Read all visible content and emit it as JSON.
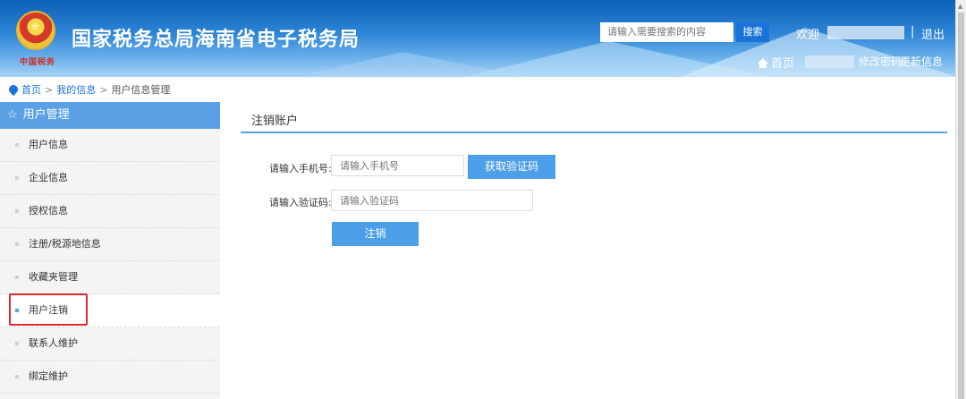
{
  "header": {
    "site_title": "国家税务总局海南省电子税务局",
    "slogan": "中国税务",
    "search_placeholder": "请输入需要搜索的内容",
    "search_label": "搜索",
    "welcome": "欢迎",
    "separator": "|",
    "logout": "退出",
    "home": "首页",
    "change_password": "修改密码",
    "update_info": "更新信息"
  },
  "breadcrumb": {
    "items": [
      "首页",
      "我的信息",
      "用户信息管理"
    ],
    "separator": ">"
  },
  "sidebar": {
    "title": "用户管理",
    "items": [
      {
        "label": "用户信息"
      },
      {
        "label": "企业信息"
      },
      {
        "label": "授权信息"
      },
      {
        "label": "注册/税源地信息"
      },
      {
        "label": "收藏夹管理"
      },
      {
        "label": "用户注销",
        "active": true
      },
      {
        "label": "联系人维护"
      },
      {
        "label": "绑定维护"
      }
    ]
  },
  "main": {
    "title": "注销账户",
    "phone_label": "请输入手机号:",
    "phone_placeholder": "请输入手机号",
    "get_code_label": "获取验证码",
    "code_label": "请输入验证码:",
    "code_placeholder": "请输入验证码",
    "submit_label": "注销"
  },
  "colors": {
    "accent": "#59a0e5",
    "header_dark": "#0d5fb8",
    "highlight": "#e02a2a"
  },
  "icons": [
    "emblem-icon",
    "home-icon",
    "location-pin-icon",
    "star-outline-icon",
    "scroll-up-icon"
  ]
}
